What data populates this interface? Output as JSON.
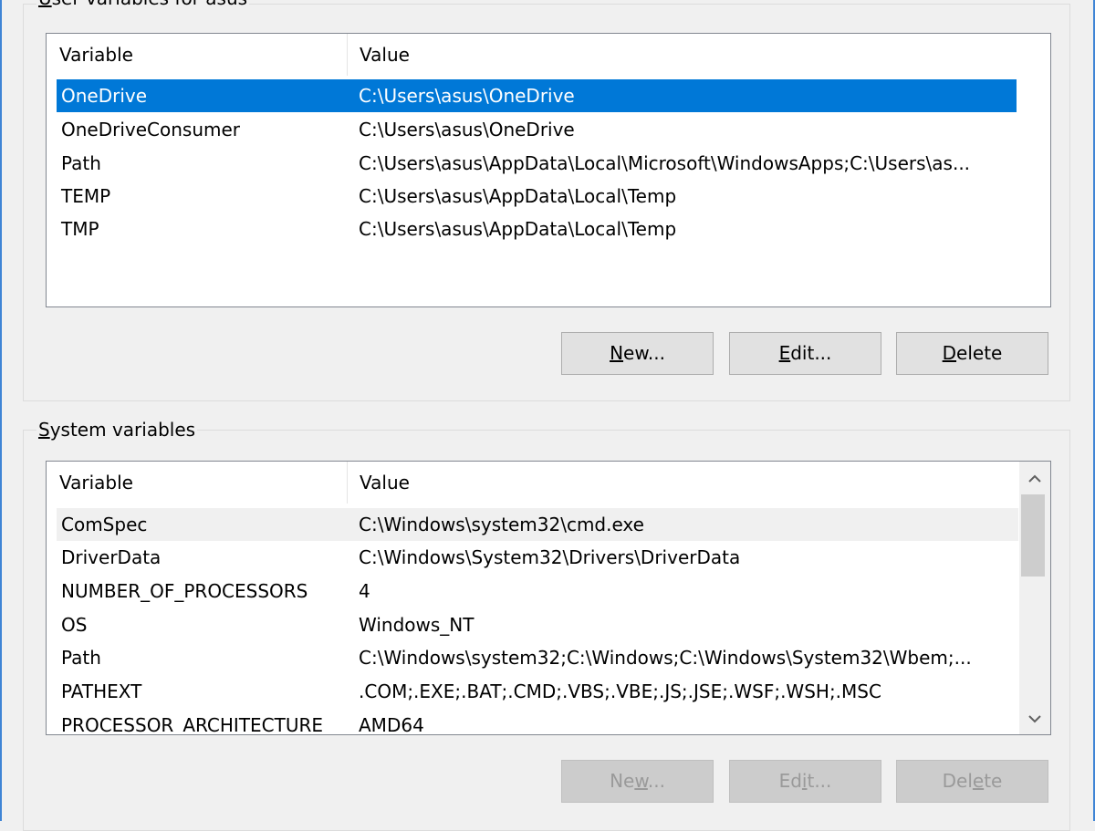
{
  "user_group": {
    "caption_prefix": "U",
    "caption_rest": "ser variables for asus",
    "columns": [
      "Variable",
      "Value"
    ],
    "rows": [
      {
        "variable": "OneDrive",
        "value": "C:\\Users\\asus\\OneDrive",
        "selected": true
      },
      {
        "variable": "OneDriveConsumer",
        "value": "C:\\Users\\asus\\OneDrive"
      },
      {
        "variable": "Path",
        "value": "C:\\Users\\asus\\AppData\\Local\\Microsoft\\WindowsApps;C:\\Users\\as..."
      },
      {
        "variable": "TEMP",
        "value": "C:\\Users\\asus\\AppData\\Local\\Temp"
      },
      {
        "variable": "TMP",
        "value": "C:\\Users\\asus\\AppData\\Local\\Temp"
      }
    ],
    "buttons": {
      "new_acc": "N",
      "new_rest": "ew...",
      "edit_acc": "E",
      "edit_rest": "dit...",
      "delete_acc": "D",
      "delete_rest": "elete"
    }
  },
  "system_group": {
    "caption_prefix": "S",
    "caption_rest": "ystem variables",
    "columns": [
      "Variable",
      "Value"
    ],
    "rows": [
      {
        "variable": "ComSpec",
        "value": "C:\\Windows\\system32\\cmd.exe"
      },
      {
        "variable": "DriverData",
        "value": "C:\\Windows\\System32\\Drivers\\DriverData"
      },
      {
        "variable": "NUMBER_OF_PROCESSORS",
        "value": "4"
      },
      {
        "variable": "OS",
        "value": "Windows_NT"
      },
      {
        "variable": "Path",
        "value": "C:\\Windows\\system32;C:\\Windows;C:\\Windows\\System32\\Wbem;..."
      },
      {
        "variable": "PATHEXT",
        "value": ".COM;.EXE;.BAT;.CMD;.VBS;.VBE;.JS;.JSE;.WSF;.WSH;.MSC"
      },
      {
        "variable": "PROCESSOR_ARCHITECTURE",
        "value": "AMD64"
      }
    ],
    "buttons": {
      "new_pre": "Ne",
      "new_acc": "w",
      "new_rest": "...",
      "edit_pre": "Ed",
      "edit_acc": "i",
      "edit_rest": "t...",
      "delete_pre": "Del",
      "delete_acc": "e",
      "delete_rest": "te"
    },
    "scroll_up_icon": "chevron-up",
    "scroll_down_icon": "chevron-down"
  },
  "colors": {
    "selection": "#0078d7",
    "window_border": "#3f84d5",
    "disabled_text": "#9a9a9a"
  }
}
